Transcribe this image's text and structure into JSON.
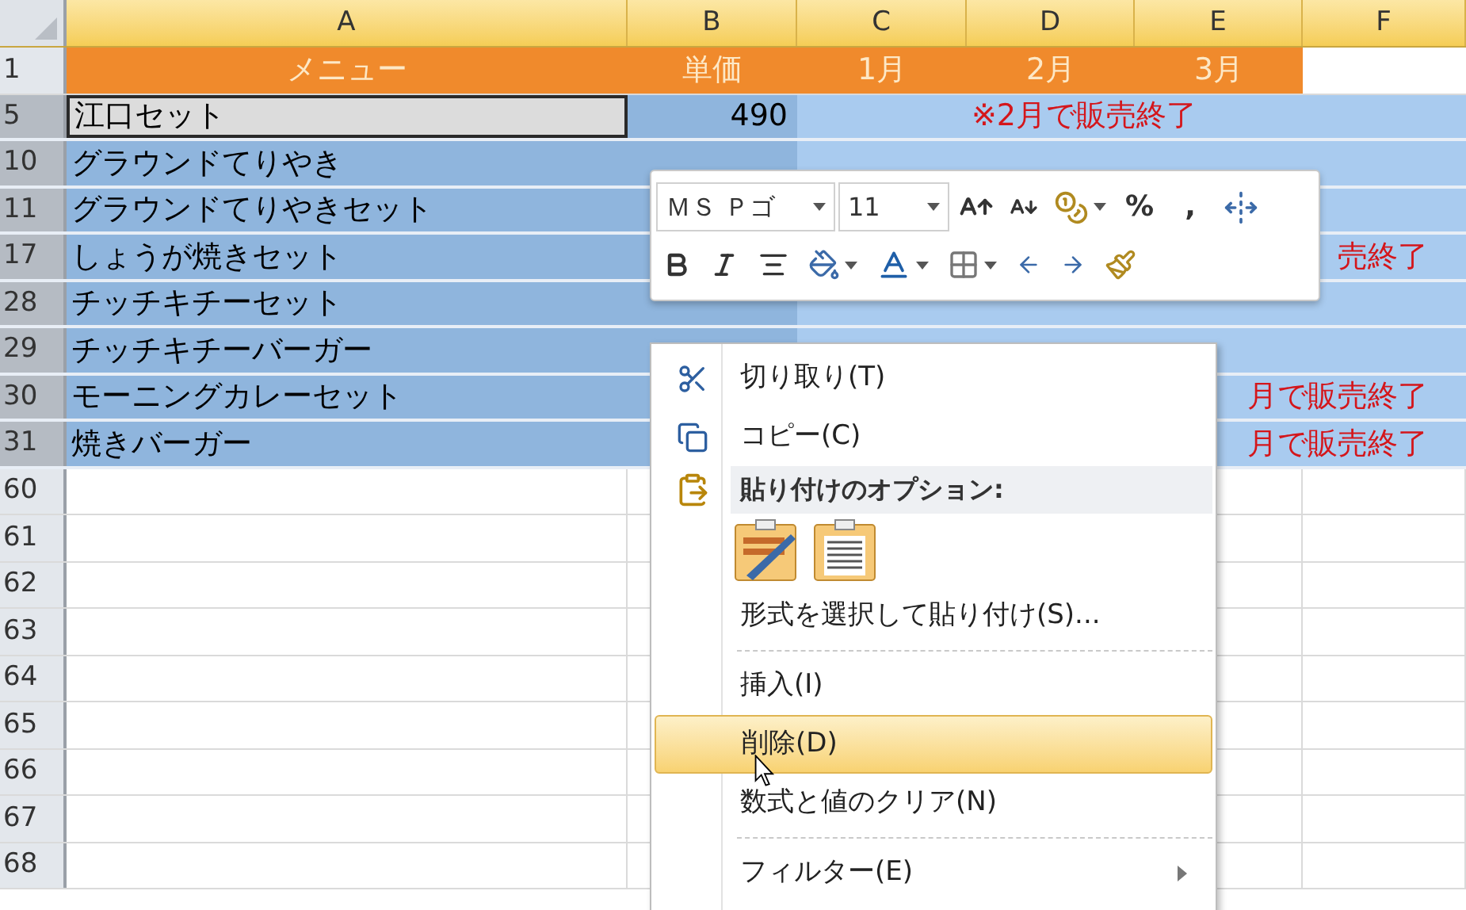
{
  "column_headers": [
    "A",
    "B",
    "C",
    "D",
    "E",
    "F"
  ],
  "rows": [
    {
      "number": "1",
      "kind": "header",
      "selected": false,
      "active": false,
      "cells": {
        "A": "メニュー",
        "B": "単価",
        "C": "1月",
        "D": "2月",
        "E": "3月"
      }
    },
    {
      "number": "5",
      "kind": "data",
      "selected": true,
      "active": true,
      "cells": {
        "A": "江口セット",
        "B": "490",
        "D": "※2月で販売終了"
      }
    },
    {
      "number": "10",
      "kind": "data",
      "selected": true,
      "active": false,
      "cells": {
        "A": "グラウンドてりやき"
      }
    },
    {
      "number": "11",
      "kind": "data",
      "selected": true,
      "active": false,
      "cells": {
        "A": "グラウンドてりやきセット"
      }
    },
    {
      "number": "17",
      "kind": "data",
      "selected": true,
      "active": false,
      "cells": {
        "A": "しょうが焼きセット",
        "tail": "売終了"
      }
    },
    {
      "number": "28",
      "kind": "data",
      "selected": true,
      "active": false,
      "cells": {
        "A": "チッチキチーセット"
      }
    },
    {
      "number": "29",
      "kind": "data",
      "selected": true,
      "active": false,
      "cells": {
        "A": "チッチキチーバーガー"
      }
    },
    {
      "number": "30",
      "kind": "data",
      "selected": true,
      "active": false,
      "cells": {
        "A": "モーニングカレーセット",
        "tail": "月で販売終了"
      }
    },
    {
      "number": "31",
      "kind": "data",
      "selected": true,
      "active": false,
      "cells": {
        "A": "焼きバーガー",
        "tail": "月で販売終了"
      }
    },
    {
      "number": "60",
      "kind": "data",
      "selected": false,
      "active": false,
      "cells": {}
    },
    {
      "number": "61",
      "kind": "data",
      "selected": false,
      "active": false,
      "cells": {}
    },
    {
      "number": "62",
      "kind": "data",
      "selected": false,
      "active": false,
      "cells": {}
    },
    {
      "number": "63",
      "kind": "data",
      "selected": false,
      "active": false,
      "cells": {}
    },
    {
      "number": "64",
      "kind": "data",
      "selected": false,
      "active": false,
      "cells": {}
    },
    {
      "number": "65",
      "kind": "data",
      "selected": false,
      "active": false,
      "cells": {}
    },
    {
      "number": "66",
      "kind": "data",
      "selected": false,
      "active": false,
      "cells": {}
    },
    {
      "number": "67",
      "kind": "data",
      "selected": false,
      "active": false,
      "cells": {}
    },
    {
      "number": "68",
      "kind": "data",
      "selected": false,
      "active": false,
      "cells": {}
    }
  ],
  "mini_toolbar": {
    "font_field": {
      "value": "ＭＳ Ｐゴ"
    },
    "size_field": {
      "value": "11"
    },
    "text_buttons": [
      "%",
      ","
    ]
  },
  "context_menu": {
    "items": [
      {
        "kind": "command",
        "label": "切り取り(T)",
        "selected": false,
        "submenu": false
      },
      {
        "kind": "command",
        "label": "コピー(C)",
        "selected": false,
        "submenu": false
      },
      {
        "kind": "group_header",
        "label": "貼り付けのオプション:"
      },
      {
        "kind": "paste_options"
      },
      {
        "kind": "command",
        "label": "形式を選択して貼り付け(S)...",
        "selected": false,
        "submenu": false
      },
      {
        "kind": "separator"
      },
      {
        "kind": "command",
        "label": "挿入(I)",
        "selected": false,
        "submenu": false
      },
      {
        "kind": "command",
        "label": "削除(D)",
        "selected": true,
        "submenu": false
      },
      {
        "kind": "command",
        "label": "数式と値のクリア(N)",
        "selected": false,
        "submenu": false
      },
      {
        "kind": "separator"
      },
      {
        "kind": "command",
        "label": "フィルター(E)",
        "selected": false,
        "submenu": true
      }
    ]
  }
}
